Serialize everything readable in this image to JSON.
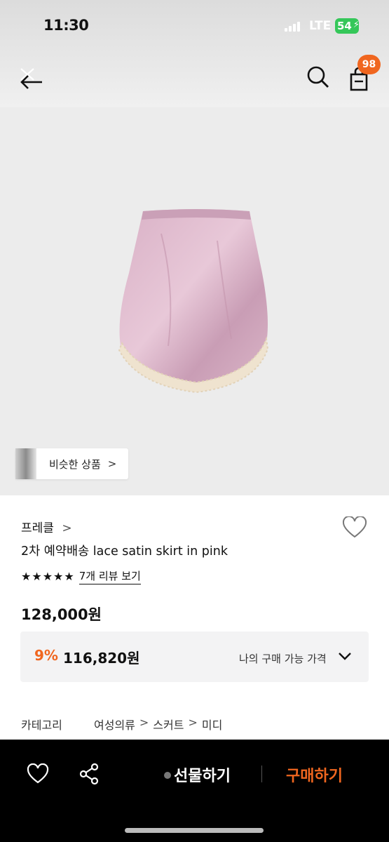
{
  "status_bar": {
    "time": "11:30",
    "network": "LTE",
    "battery": "54"
  },
  "nav": {
    "back_icon": "back-arrow-icon",
    "search_icon": "search-icon",
    "cart_icon": "shopping-bag-icon",
    "cart_count": "98"
  },
  "product_image": {
    "similar_label": "비슷한 상품",
    "similar_chevron": ">"
  },
  "product": {
    "brand": "프레클",
    "brand_chevron": ">",
    "name": "2차 예약배송 lace satin skirt in pink",
    "stars": "★★★★★",
    "review_link": "7개 리뷰 보기",
    "price": "128,000원"
  },
  "discount": {
    "rate": "9%",
    "price": "116,820원",
    "my_price_label": "나의 구매 가능 가격"
  },
  "category": {
    "label": "카테고리",
    "path": [
      "여성의류",
      "스커트",
      "미디"
    ],
    "separator": ">"
  },
  "bottom_bar": {
    "gift_label": "선물하기",
    "buy_label": "구매하기"
  },
  "colors": {
    "accent": "#f0661f",
    "bottom_bar_bg": "#000000",
    "battery": "#35c759"
  }
}
